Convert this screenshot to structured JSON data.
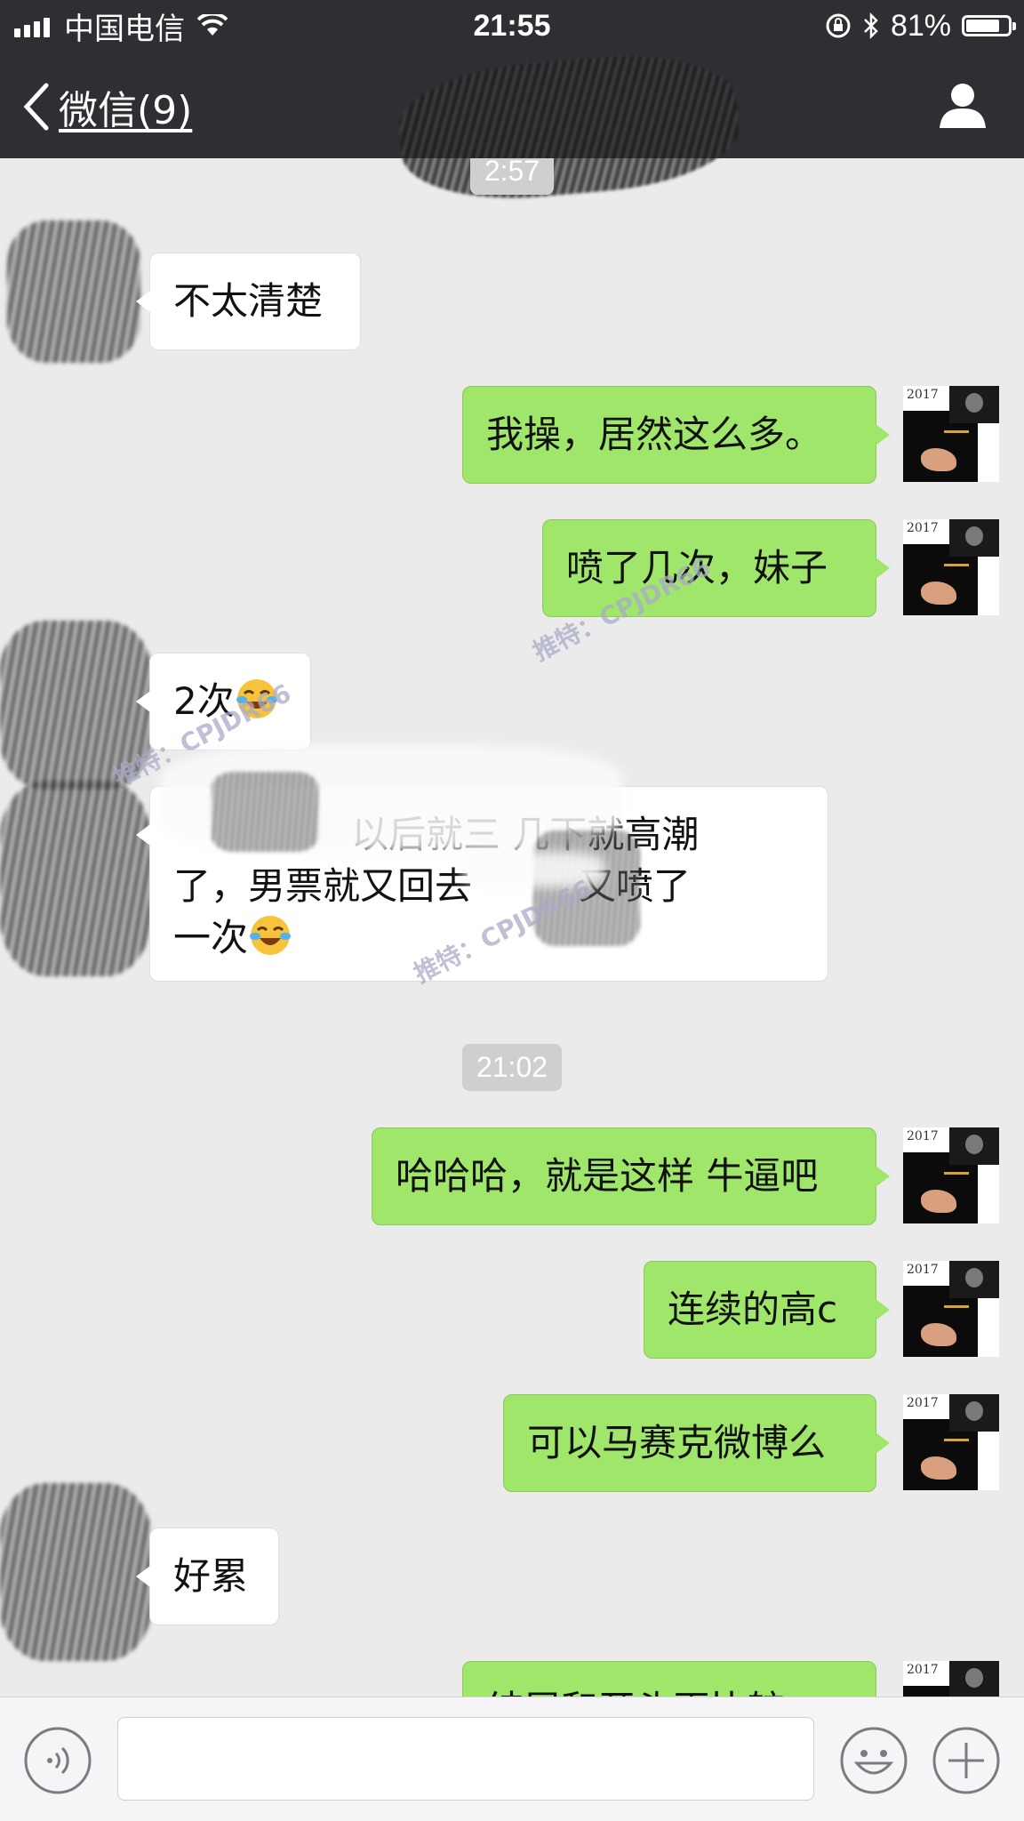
{
  "status_bar": {
    "carrier": "中国电信",
    "time": "21:55",
    "battery_text": "81%",
    "battery_level": 0.81,
    "icons": [
      "signal-icon",
      "wifi-icon",
      "rotation-lock-icon",
      "bluetooth-icon",
      "battery-icon"
    ]
  },
  "nav": {
    "back_label": "微信(9)",
    "profile_icon": "person-icon"
  },
  "chat": {
    "timestamps": {
      "top_partial": "2:57",
      "mid": "21:02"
    },
    "messages": [
      {
        "side": "in",
        "text": "不太清楚"
      },
      {
        "side": "out",
        "text": "我操，居然这么多。"
      },
      {
        "side": "out",
        "text": "喷了几次，妹子"
      },
      {
        "side": "in",
        "text": "2次",
        "emoji": "crying-laughing-emoji"
      },
      {
        "side": "in",
        "line1": "以后就三    几下就高潮",
        "line2": "了，男票就又回去",
        "line2b": "又喷了",
        "line3": "一次",
        "emoji": "crying-laughing-emoji"
      },
      {
        "side": "out",
        "text": "哈哈哈，就是这样 牛逼吧"
      },
      {
        "side": "out",
        "text": "连续的高c"
      },
      {
        "side": "out",
        "text": "可以马赛克微博么"
      },
      {
        "side": "in",
        "text": "好累"
      },
      {
        "side": "out",
        "text": "结尾和开头再比较"
      }
    ],
    "avatar_year": "2017",
    "watermark": "推特：CPJDR66"
  },
  "input_bar": {
    "voice_icon": "voice-icon",
    "emoji_icon": "emoji-icon",
    "plus_icon": "plus-icon",
    "value": ""
  },
  "colors": {
    "bar_bg": "#2e2e33",
    "chat_bg": "#ebebeb",
    "out_bubble": "#9fe66a",
    "in_bubble": "#ffffff"
  }
}
